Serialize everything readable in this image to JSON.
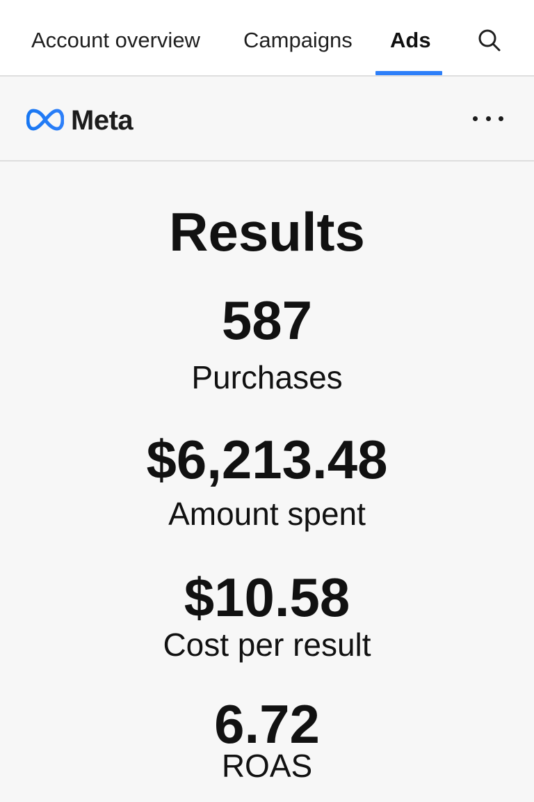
{
  "tabs": [
    {
      "label": "Account overview"
    },
    {
      "label": "Campaigns"
    },
    {
      "label": "Ads",
      "active": true
    }
  ],
  "icons": {
    "search": "search-icon",
    "more": "more-options-icon",
    "brand": "meta-logo-icon"
  },
  "brand": {
    "name": "Meta",
    "accent": "#2d7ff9"
  },
  "results": {
    "title": "Results",
    "metrics": [
      {
        "value": "587",
        "label": "Purchases"
      },
      {
        "value": "$6,213.48",
        "label": "Amount spent"
      },
      {
        "value": "$10.58",
        "label": "Cost per result"
      },
      {
        "value": "6.72",
        "label": "ROAS"
      }
    ]
  }
}
